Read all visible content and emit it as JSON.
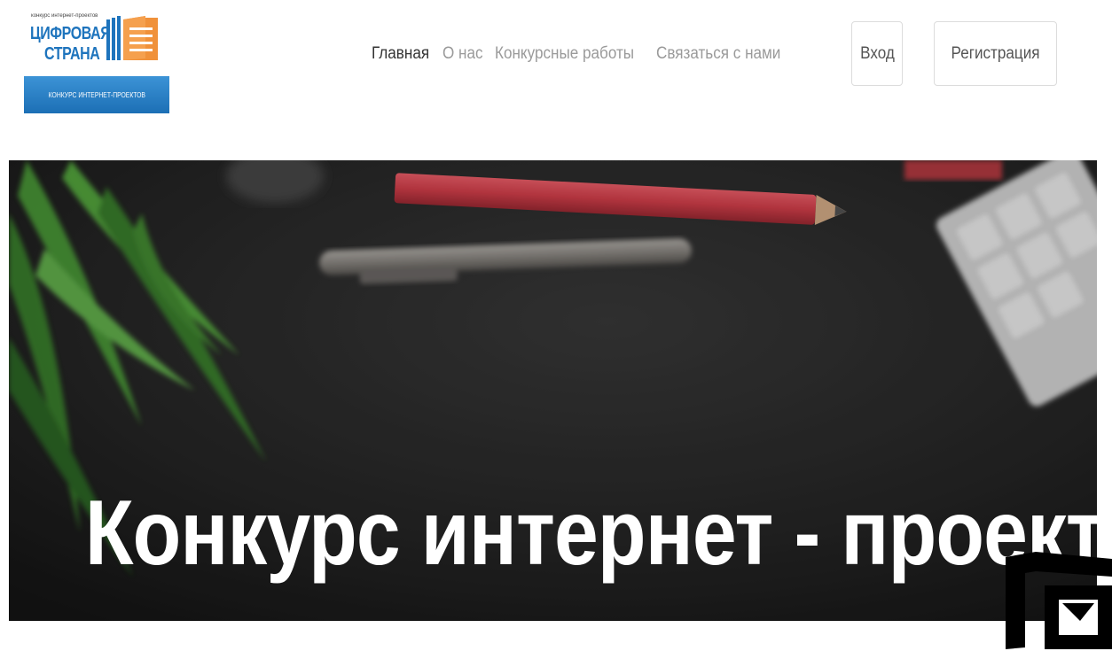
{
  "logo": {
    "small_caption": "конкурс интернет-проектов",
    "line1": "ЦИФРОВАЯ",
    "line2": "СТРАНА",
    "bar_text": "КОНКУРС ИНТЕРНЕТ-ПРОЕКТОВ",
    "mark_icon": "orange-document-stack-icon",
    "colors": {
      "blue": "#1e74bd",
      "orange": "#f0913a",
      "bar": "#2a80c8"
    }
  },
  "nav": {
    "items": [
      {
        "label": "Главная",
        "active": true
      },
      {
        "label": "О нас",
        "active": false
      },
      {
        "label": "Конкурсные работы",
        "active": false
      },
      {
        "label": "Связаться с нами",
        "active": false
      }
    ]
  },
  "auth": {
    "login_label": "Вход",
    "register_label": "Регистрация"
  },
  "hero": {
    "title": "Конкурс интернет - проектов",
    "background": "dark-desk-with-pencil-pen-plant-photo"
  },
  "watermark": {
    "icon": "black-geometric-logo-icon"
  }
}
